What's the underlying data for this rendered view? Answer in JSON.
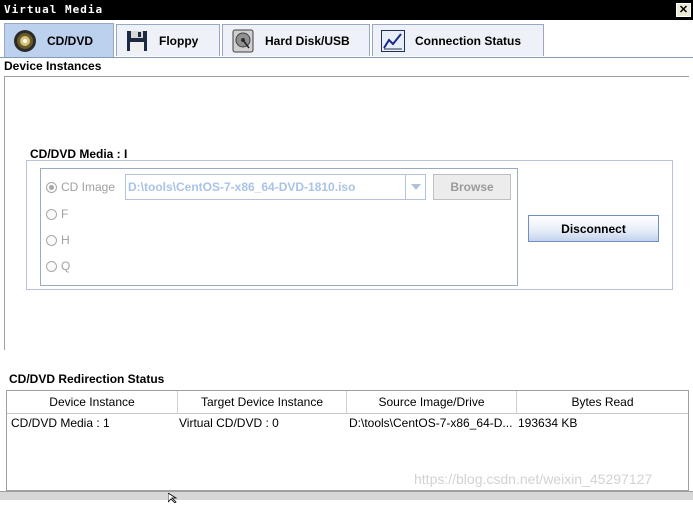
{
  "window": {
    "title": "Virtual Media",
    "close_glyph": "✕"
  },
  "tabs": [
    {
      "label": "CD/DVD",
      "icon": "cd-disc-icon",
      "active": true
    },
    {
      "label": "Floppy",
      "icon": "floppy-disk-icon",
      "active": false
    },
    {
      "label": "Hard Disk/USB",
      "icon": "hard-disk-icon",
      "active": false
    },
    {
      "label": "Connection Status",
      "icon": "chart-icon",
      "active": false
    }
  ],
  "device_instances": {
    "section_title": "Device Instances",
    "group_label": "CD/DVD Media :  I",
    "options": [
      {
        "label": "CD Image",
        "selected": true
      },
      {
        "label": "F",
        "selected": false
      },
      {
        "label": "H",
        "selected": false
      },
      {
        "label": "Q",
        "selected": false
      }
    ],
    "image_path": "D:\\tools\\CentOS-7-x86_64-DVD-1810.iso",
    "browse_label": "Browse",
    "disconnect_label": "Disconnect"
  },
  "redirection_status": {
    "section_title": "CD/DVD Redirection Status",
    "columns": [
      "Device Instance",
      "Target Device Instance",
      "Source Image/Drive",
      "Bytes Read"
    ],
    "rows": [
      [
        "CD/DVD Media :  1",
        "Virtual CD/DVD : 0",
        "D:\\tools\\CentOS-7-x86_64-D...",
        "193634 KB"
      ]
    ]
  },
  "watermark": "https://blog.csdn.net/weixin_45297127",
  "colors": {
    "active_tab": "#bcd1ee",
    "disabled_text": "#a0a0a0",
    "path_text": "#a9c3e8"
  }
}
